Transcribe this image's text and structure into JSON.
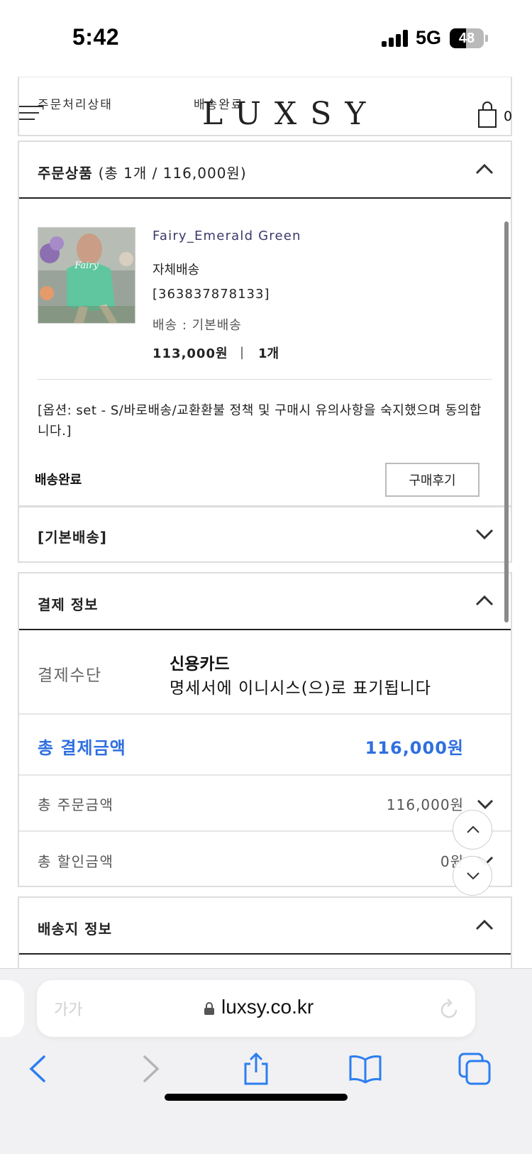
{
  "status_bar": {
    "time": "5:42",
    "network": "5G",
    "battery": "48",
    "battery_level": 0.48
  },
  "header": {
    "order_status_label": "주문처리상태",
    "order_status_value": "배송완료",
    "logo": "LUXSY",
    "cart_count": "0"
  },
  "order_items": {
    "title": "주문상품",
    "summary": "(총 1개 / 116,000원)",
    "product": {
      "thumbnail_text": "Fairy",
      "name": "Fairy_Emerald Green",
      "shipping_type": "자체배송",
      "order_code": "[363837878133]",
      "shipping_method": "배송 : 기본배송",
      "price": "113,000원",
      "separator": "|",
      "quantity": "1개",
      "option": "[옵션: set - S/바로배송/교환환불 정책 및 구매시 유의사항을 숙지했으며 동의합니다.]",
      "status": "배송완료",
      "review_button": "구매후기"
    }
  },
  "basic_shipping": {
    "title": "[기본배송]"
  },
  "payment": {
    "title": "결제 정보",
    "method_label": "결제수단",
    "method_name": "신용카드",
    "method_note": "명세서에 이니시스(으)로 표기됩니다",
    "total_label": "총 결제금액",
    "total_value": "116,000원",
    "order_amount_label": "총 주문금액",
    "order_amount_value": "116,000원",
    "discount_label": "총 할인금액",
    "discount_value": "0원"
  },
  "delivery_info": {
    "title": "배송지 정보"
  },
  "browser": {
    "text_size": "가가",
    "url": "luxsy.co.kr"
  },
  "colors": {
    "accent_blue": "#2f6fe0",
    "ios_blue": "#2b7ef0"
  }
}
